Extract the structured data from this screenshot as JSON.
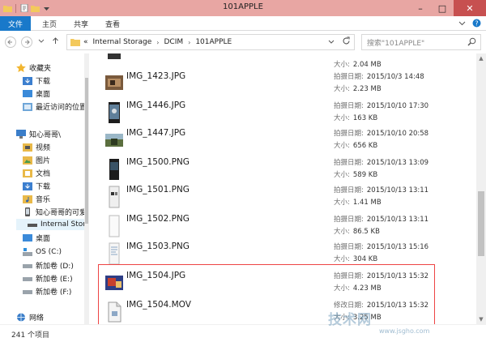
{
  "window": {
    "title": "101APPLE",
    "minimize": "–",
    "maximize": "□",
    "close": "✕"
  },
  "ribbon": {
    "file": "文件",
    "tabs": [
      "主页",
      "共享",
      "查看"
    ]
  },
  "address": {
    "prefix": "«",
    "crumbs": [
      "Internal Storage",
      "DCIM",
      "101APPLE"
    ]
  },
  "search": {
    "placeholder": "搜索\"101APPLE\""
  },
  "nav": {
    "favorites": "收藏夹",
    "fav_items": [
      "下载",
      "桌面",
      "最近访问的位置"
    ],
    "pc": "知心哥哥\\",
    "pc_items": [
      "视频",
      "图片",
      "文档",
      "下载",
      "音乐"
    ],
    "device": "知心哥哥的可爱小",
    "storage": "Internal Stora",
    "desktop": "桌面",
    "drives": [
      "OS (C:)",
      "新加卷 (D:)",
      "新加卷 (E:)",
      "新加卷 (F:)"
    ],
    "network": "网络"
  },
  "files": [
    {
      "name": "",
      "date_label": "",
      "date": "",
      "size_label": "大小:",
      "size": "2.04 MB",
      "thumb": "partial"
    },
    {
      "name": "IMG_1423.JPG",
      "date_label": "拍摄日期:",
      "date": "2015/10/3 14:48",
      "size_label": "大小:",
      "size": "2.23 MB",
      "thumb": "photo-a"
    },
    {
      "name": "IMG_1446.JPG",
      "date_label": "拍摄日期:",
      "date": "2015/10/10 17:30",
      "size_label": "大小:",
      "size": "163 KB",
      "thumb": "photo-b"
    },
    {
      "name": "IMG_1447.JPG",
      "date_label": "拍摄日期:",
      "date": "2015/10/10 20:58",
      "size_label": "大小:",
      "size": "656 KB",
      "thumb": "photo-c"
    },
    {
      "name": "IMG_1500.PNG",
      "date_label": "拍摄日期:",
      "date": "2015/10/13 13:09",
      "size_label": "大小:",
      "size": "589 KB",
      "thumb": "screen-dark"
    },
    {
      "name": "IMG_1501.PNG",
      "date_label": "拍摄日期:",
      "date": "2015/10/13 13:11",
      "size_label": "大小:",
      "size": "1.41 MB",
      "thumb": "screen-light"
    },
    {
      "name": "IMG_1502.PNG",
      "date_label": "拍摄日期:",
      "date": "2015/10/13 13:11",
      "size_label": "大小:",
      "size": "86.5 KB",
      "thumb": "screen-white"
    },
    {
      "name": "IMG_1503.PNG",
      "date_label": "拍摄日期:",
      "date": "2015/10/13 15:16",
      "size_label": "大小:",
      "size": "304 KB",
      "thumb": "screen-doc"
    },
    {
      "name": "IMG_1504.JPG",
      "date_label": "拍摄日期:",
      "date": "2015/10/13 15:32",
      "size_label": "大小:",
      "size": "4.23 MB",
      "thumb": "photo-d"
    },
    {
      "name": "IMG_1504.MOV",
      "date_label": "修改日期:",
      "date": "2015/10/13 15:32",
      "size_label": "大小:",
      "size": "3.25 MB",
      "thumb": "video"
    }
  ],
  "status": {
    "count": "241 个项目"
  },
  "watermark": {
    "text": "技术网",
    "url": "www.jsgho.com"
  },
  "colors": {
    "titlebar": "#e8a6a3",
    "file_tab": "#1979ca",
    "close": "#c75050",
    "highlight": "#e44444"
  }
}
